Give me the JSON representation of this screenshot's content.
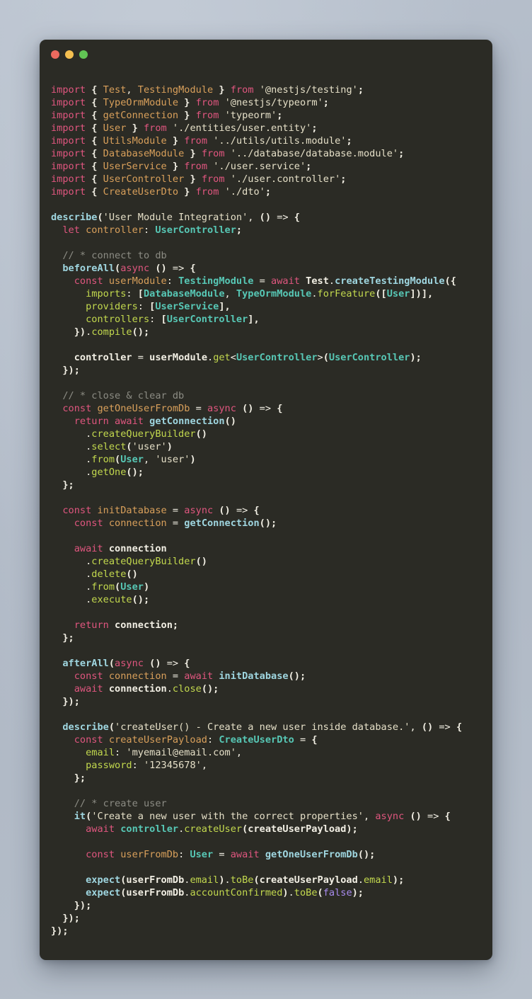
{
  "window": {
    "background_color": "#2b2b25",
    "page_background_color": "#b4bdc9",
    "traffic_lights": [
      {
        "name": "close",
        "color": "#ec6a5f"
      },
      {
        "name": "minimize",
        "color": "#f4bf50"
      },
      {
        "name": "maximize",
        "color": "#61c554"
      }
    ]
  },
  "theme": {
    "keyword": "#e0567f",
    "imported": "#d9a05b",
    "string": "#e6e0c8",
    "punctuation": "#f2efe4",
    "function": "#9fd6e0",
    "type": "#57c7b5",
    "property": "#c3d94e",
    "variable": "#f2efe4",
    "comment": "#8c8c84",
    "boolean": "#a98cf0"
  },
  "code": {
    "language": "typescript",
    "filename_hint": "user.integration.spec.ts",
    "lines": [
      "import { Test, TestingModule } from '@nestjs/testing';",
      "import { TypeOrmModule } from '@nestjs/typeorm';",
      "import { getConnection } from 'typeorm';",
      "import { User } from './entities/user.entity';",
      "import { UtilsModule } from '../utils/utils.module';",
      "import { DatabaseModule } from '../database/database.module';",
      "import { UserService } from './user.service';",
      "import { UserController } from './user.controller';",
      "import { CreateUserDto } from './dto';",
      "",
      "describe('User Module Integration', () => {",
      "  let controller: UserController;",
      "",
      "  // * connect to db",
      "  beforeAll(async () => {",
      "    const userModule: TestingModule = await Test.createTestingModule({",
      "      imports: [DatabaseModule, TypeOrmModule.forFeature([User])],",
      "      providers: [UserService],",
      "      controllers: [UserController],",
      "    }).compile();",
      "",
      "    controller = userModule.get<UserController>(UserController);",
      "  });",
      "",
      "  // * close & clear db",
      "  const getOneUserFromDb = async () => {",
      "    return await getConnection()",
      "      .createQueryBuilder()",
      "      .select('user')",
      "      .from(User, 'user')",
      "      .getOne();",
      "  };",
      "",
      "  const initDatabase = async () => {",
      "    const connection = getConnection();",
      "",
      "    await connection",
      "      .createQueryBuilder()",
      "      .delete()",
      "      .from(User)",
      "      .execute();",
      "",
      "    return connection;",
      "  };",
      "",
      "  afterAll(async () => {",
      "    const connection = await initDatabase();",
      "    await connection.close();",
      "  });",
      "",
      "  describe('createUser() - Create a new user inside database.', () => {",
      "    const createUserPayload: CreateUserDto = {",
      "      email: 'myemail@email.com',",
      "      password: '12345678',",
      "    };",
      "",
      "    // * create user",
      "    it('Create a new user with the correct properties', async () => {",
      "      await controller.createUser(createUserPayload);",
      "",
      "      const userFromDb: User = await getOneUserFromDb();",
      "",
      "      expect(userFromDb.email).toBe(createUserPayload.email);",
      "      expect(userFromDb.accountConfirmed).toBe(false);",
      "    });",
      "  });",
      "});"
    ],
    "strings": [
      "'@nestjs/testing'",
      "'@nestjs/typeorm'",
      "'typeorm'",
      "'./entities/user.entity'",
      "'../utils/utils.module'",
      "'../database/database.module'",
      "'./user.service'",
      "'./user.controller'",
      "'./dto'",
      "'User Module Integration'",
      "'user'",
      "'createUser() - Create a new user inside database.'",
      "'myemail@email.com'",
      "'12345678'",
      "'Create a new user with the correct properties'"
    ],
    "comments": [
      "// * connect to db",
      "// * close & clear db",
      "// * create user"
    ]
  }
}
